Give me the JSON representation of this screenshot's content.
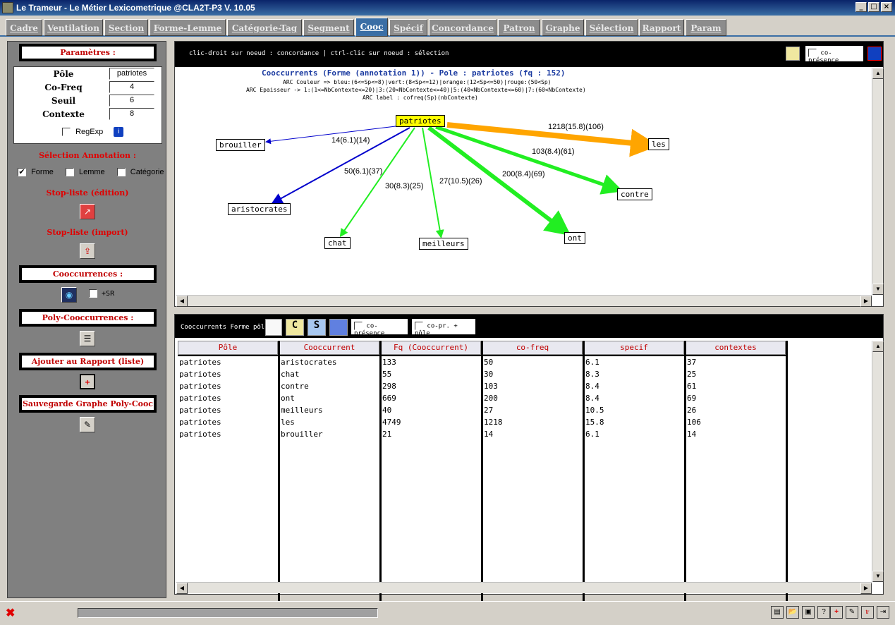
{
  "window": {
    "title": "Le Trameur - Le Métier Lexicometrique @CLA2T-P3 V. 10.05"
  },
  "tabs": [
    {
      "label": "Cadre"
    },
    {
      "label": "Ventilation"
    },
    {
      "label": "Section"
    },
    {
      "label": "Forme-Lemme"
    },
    {
      "label": "Catégorie-Tag"
    },
    {
      "label": "Segment"
    },
    {
      "label": "Cooc"
    },
    {
      "label": "Spécif"
    },
    {
      "label": "Concordance"
    },
    {
      "label": "Patron"
    },
    {
      "label": "Graphe"
    },
    {
      "label": "Sélection"
    },
    {
      "label": "Rapport"
    },
    {
      "label": "Param"
    }
  ],
  "left": {
    "params_title": "Paramètres :",
    "pole_label": "Pôle",
    "pole_value": "patriotes",
    "cofreq_label": "Co-Freq",
    "cofreq_value": "4",
    "seuil_label": "Seuil",
    "seuil_value": "6",
    "contexte_label": "Contexte",
    "contexte_value": "8",
    "regexp_label": "RegExp",
    "selection_title": "Sélection Annotation :",
    "forme_label": "Forme",
    "lemme_label": "Lemme",
    "categorie_label": "Catégorie",
    "forme_checked": "✔",
    "stop_edit_title": "Stop-liste (édition)",
    "stop_import_title": "Stop-liste (import)",
    "cooc_title": "Cooccurrences :",
    "sr_label": "+SR",
    "polycooc_title": "Poly-Cooccurrences :",
    "ajouter_title": "Ajouter au Rapport (liste)",
    "sauvegarde_title": "Sauvegarde Graphe Poly-Cooc"
  },
  "graph": {
    "hint": "clic-droit sur noeud : concordance | ctrl-clic sur noeud : sélection",
    "copresence_label": "co-présence",
    "header_title": "Cooccurrents (Forme (annotation 1)) - Pole : patriotes (fq : 152)",
    "legend_color": "ARC Couleur => bleu:(6<=Sp<=8)|vert:(8<Sp<=12)|orange:(12<Sp<=50)|rouge:(50<Sp)",
    "legend_width": "ARC Epaisseur -> 1:(1<=NbContexte<=20)|3:(20<NbContexte<=40)|5:(40<NbContexte<=60)|7:(60<NbContexte)",
    "legend_label": "ARC label : cofreq(Sp)(nbContexte)",
    "pole": "patriotes",
    "nodes": [
      "brouiller",
      "aristocrates",
      "chat",
      "meilleurs",
      "ont",
      "contre",
      "les"
    ],
    "edge_labels": [
      "14(6.1)(14)",
      "50(6.1)(37)",
      "30(8.3)(25)",
      "27(10.5)(26)",
      "200(8.4)(69)",
      "103(8.4)(61)",
      "1218(15.8)(106)"
    ],
    "colors": {
      "blue": "#0000cc",
      "green": "#22ee22",
      "orange": "#ffa500",
      "pole_bg": "#ffff00"
    }
  },
  "table": {
    "toolbar_label": "Cooccurrents Forme pôle",
    "copresence_label": "co-présence",
    "copr_pole_label": "co-pr. + pôle",
    "columns": [
      "Pôle",
      "Cooccurrent",
      "Fq (Cooccurrent)",
      "co-freq",
      "specif",
      "contextes"
    ],
    "rows": [
      [
        "patriotes",
        "aristocrates",
        "133",
        "50",
        "6.1",
        "37"
      ],
      [
        "patriotes",
        "chat",
        "55",
        "30",
        "8.3",
        "25"
      ],
      [
        "patriotes",
        "contre",
        "298",
        "103",
        "8.4",
        "61"
      ],
      [
        "patriotes",
        "ont",
        "669",
        "200",
        "8.4",
        "69"
      ],
      [
        "patriotes",
        "meilleurs",
        "40",
        "27",
        "10.5",
        "26"
      ],
      [
        "patriotes",
        "les",
        "4749",
        "1218",
        "15.8",
        "106"
      ],
      [
        "patriotes",
        "brouiller",
        "21",
        "14",
        "6.1",
        "14"
      ]
    ]
  }
}
